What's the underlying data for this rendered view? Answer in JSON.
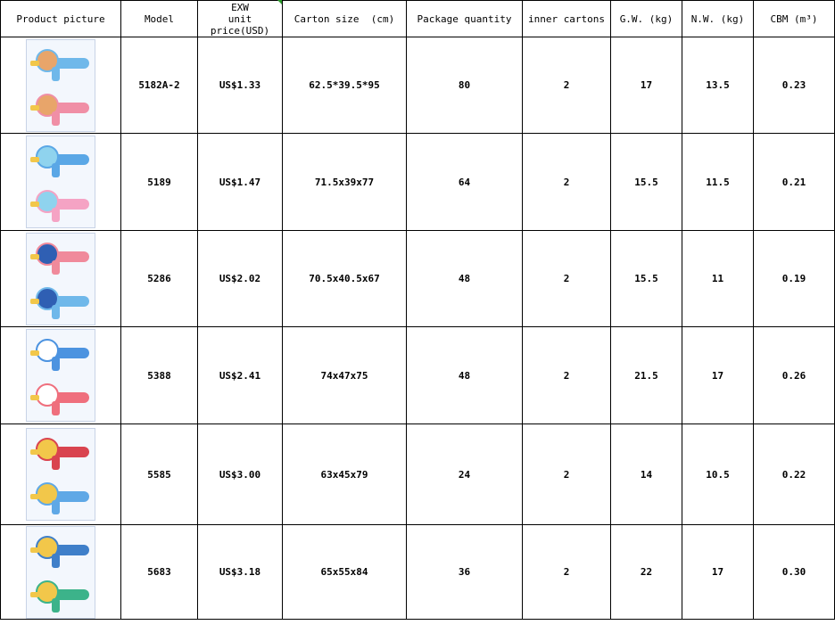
{
  "headers": {
    "picture": "Product picture",
    "model": "Model",
    "price_line1": "EXW",
    "price_line2": "unit price(USD)",
    "carton": "Carton size  (cm)",
    "package": "Package quantity",
    "inner": "inner cartons",
    "gw": "G.W. (kg)",
    "nw": "N.W. (kg)",
    "cbm": "CBM (m³)"
  },
  "rows": [
    {
      "model": "5182A-2",
      "price": "US$1.33",
      "carton": "62.5*39.5*95",
      "package": "80",
      "inner": "2",
      "gw": "17",
      "nw": "13.5",
      "cbm": "0.23",
      "colors": {
        "top": "#6fb8ea",
        "bottom": "#f08fa6",
        "accent": "#e8a56a"
      }
    },
    {
      "model": "5189",
      "price": "US$1.47",
      "carton": "71.5x39x77",
      "package": "64",
      "inner": "2",
      "gw": "15.5",
      "nw": "11.5",
      "cbm": "0.21",
      "colors": {
        "top": "#5aa7e6",
        "bottom": "#f5a3c4",
        "accent": "#8fd3ee"
      }
    },
    {
      "model": "5286",
      "price": "US$2.02",
      "carton": "70.5x40.5x67",
      "package": "48",
      "inner": "2",
      "gw": "15.5",
      "nw": "11",
      "cbm": "0.19",
      "colors": {
        "top": "#f08a9b",
        "bottom": "#6fb8ea",
        "accent": "#2f5fb3"
      }
    },
    {
      "model": "5388",
      "price": "US$2.41",
      "carton": "74x47x75",
      "package": "48",
      "inner": "2",
      "gw": "21.5",
      "nw": "17",
      "cbm": "0.26",
      "colors": {
        "top": "#4c93e0",
        "bottom": "#ef6f7d",
        "accent": "#ffffff"
      }
    },
    {
      "model": "5585",
      "price": "US$3.00",
      "carton": "63x45x79",
      "package": "24",
      "inner": "2",
      "gw": "14",
      "nw": "10.5",
      "cbm": "0.22",
      "colors": {
        "top": "#d9444f",
        "bottom": "#5fa8e6",
        "accent": "#f2c74a"
      }
    },
    {
      "model": "5683",
      "price": "US$3.18",
      "carton": "65x55x84",
      "package": "36",
      "inner": "2",
      "gw": "22",
      "nw": "17",
      "cbm": "0.30",
      "colors": {
        "top": "#3f7fc9",
        "bottom": "#3cb38a",
        "accent": "#f2c74a"
      }
    }
  ]
}
